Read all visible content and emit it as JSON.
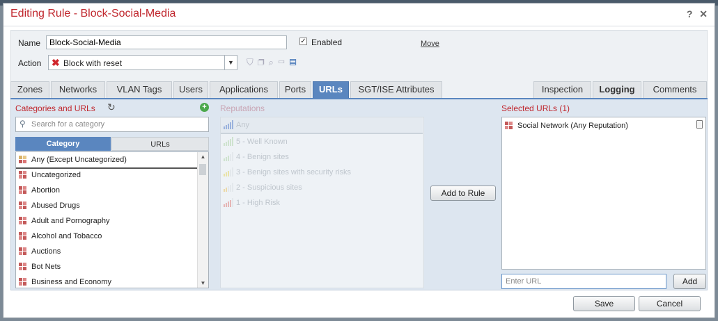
{
  "dialog": {
    "title": "Editing Rule - Block-Social-Media",
    "help": "?",
    "close": "✕"
  },
  "form": {
    "name_label": "Name",
    "name_value": "Block-Social-Media",
    "enabled_label": "Enabled",
    "enabled_checked": true,
    "move_link": "Move",
    "action_label": "Action",
    "action_value": "Block with reset"
  },
  "tabs_left": [
    "Zones",
    "Networks",
    "VLAN Tags",
    "Users",
    "Applications",
    "Ports",
    "URLs",
    "SGT/ISE Attributes"
  ],
  "active_tab": "URLs",
  "tabs_right": [
    "Inspection",
    "Logging",
    "Comments"
  ],
  "categories": {
    "header": "Categories and URLs",
    "search_placeholder": "Search for a category",
    "subtab_category": "Category",
    "subtab_urls": "URLs",
    "items": [
      "Any (Except Uncategorized)",
      "Uncategorized",
      "Abortion",
      "Abused Drugs",
      "Adult and Pornography",
      "Alcohol and Tobacco",
      "Auctions",
      "Bot Nets",
      "Business and Economy"
    ]
  },
  "reputations": {
    "header": "Reputations",
    "items": [
      "Any",
      "5 - Well Known",
      "4 - Benign sites",
      "3 - Benign sites with security risks",
      "2 - Suspicious sites",
      "1 - High Risk"
    ]
  },
  "add_to_rule": "Add to Rule",
  "selected": {
    "header": "Selected URLs (1)",
    "items": [
      "Social Network (Any Reputation)"
    ],
    "url_placeholder": "Enter URL",
    "add_button": "Add"
  },
  "footer": {
    "save": "Save",
    "cancel": "Cancel"
  },
  "colors": {
    "accent": "#5a86bf",
    "title_red": "#c0262d"
  }
}
